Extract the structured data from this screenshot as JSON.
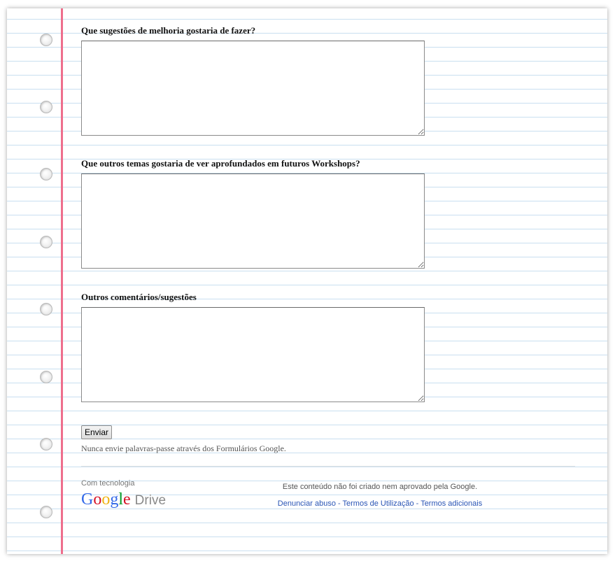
{
  "questions": [
    {
      "title": "Que sugestões de melhoria gostaria de fazer?",
      "value": ""
    },
    {
      "title": "Que outros temas gostaria de ver aprofundados em futuros Workshops?",
      "value": ""
    },
    {
      "title": "Outros comentários/sugestões",
      "value": ""
    }
  ],
  "form": {
    "submit_label": "Enviar",
    "password_warning": "Nunca envie palavras-passe através dos Formulários Google."
  },
  "footer": {
    "powered_by": "Com tecnologia",
    "logo_google": "Google",
    "logo_drive": "Drive",
    "disclaimer": "Este conteúdo não foi criado nem aprovado pela Google.",
    "links": [
      "Denunciar abuso",
      "Termos de Utilização",
      "Termos adicionais"
    ],
    "separator": " - "
  },
  "colors": {
    "margin_line": "#ee6e8c",
    "ruled_line": "#c9dff0",
    "link": "#2a55b5"
  }
}
